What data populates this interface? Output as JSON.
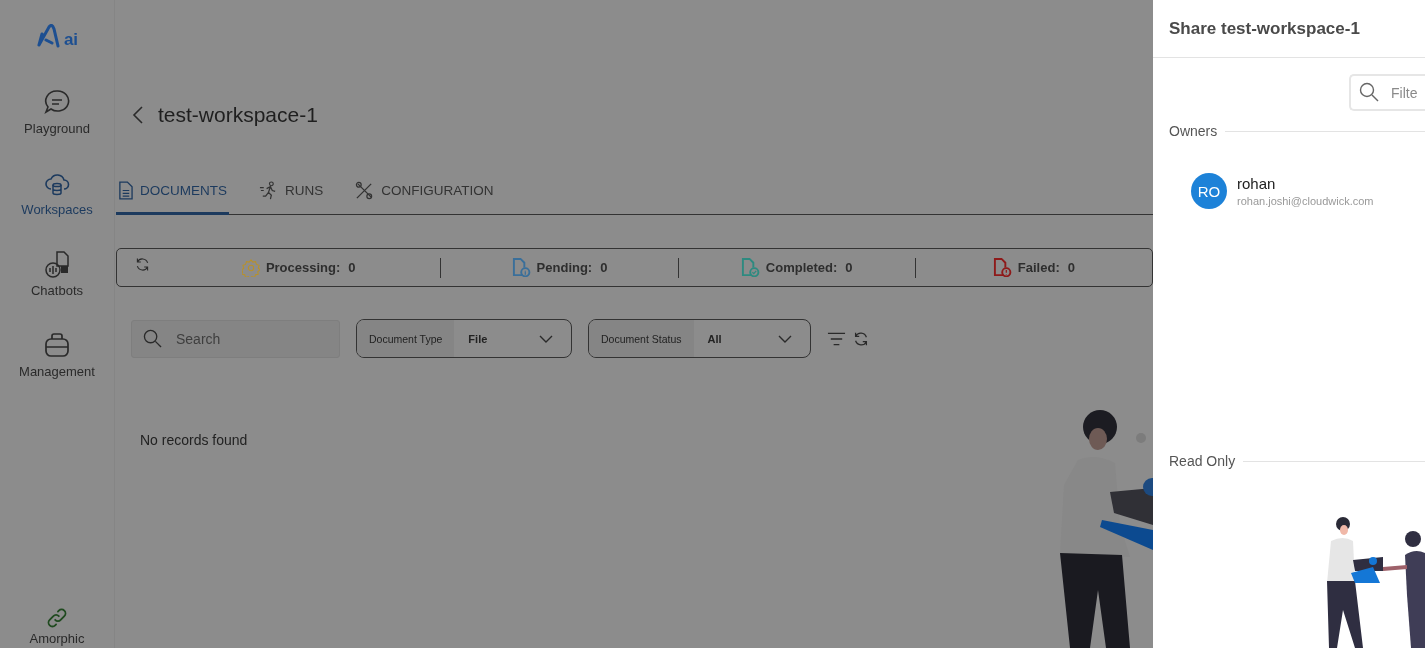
{
  "logo": {
    "text": "ai"
  },
  "sidebar": {
    "items": [
      {
        "label": "Playground",
        "kind": "chat",
        "selected": false
      },
      {
        "label": "Workspaces",
        "kind": "cloud",
        "selected": true
      },
      {
        "label": "Chatbots",
        "kind": "bot",
        "selected": false
      },
      {
        "label": "Management",
        "kind": "bag",
        "selected": false
      }
    ],
    "footer": {
      "label": "Amorphic",
      "kind": "link"
    }
  },
  "page": {
    "title": "test-workspace-1"
  },
  "tabs": [
    {
      "label": "DOCUMENTS",
      "kind": "doc",
      "selected": true
    },
    {
      "label": "RUNS",
      "kind": "run",
      "selected": false
    },
    {
      "label": "CONFIGURATION",
      "kind": "tools",
      "selected": false
    }
  ],
  "status_bar": [
    {
      "kind": "processing",
      "label": "Processing:",
      "count": "0",
      "color": "#b8912a"
    },
    {
      "kind": "pending",
      "label": "Pending:",
      "count": "0",
      "color": "#3a6f9a"
    },
    {
      "kind": "completed",
      "label": "Completed:",
      "count": "0",
      "color": "#2e8a80"
    },
    {
      "kind": "failed",
      "label": "Failed:",
      "count": "0",
      "color": "#8e1a1a"
    }
  ],
  "search": {
    "placeholder": "Search"
  },
  "filters": [
    {
      "label": "Document Type",
      "value": "File"
    },
    {
      "label": "Document Status",
      "value": "All"
    }
  ],
  "empty_message": "No records found",
  "drawer": {
    "title": "Share test-workspace-1",
    "filter": {
      "placeholder": "Filte"
    },
    "sections": [
      {
        "title": "Owners",
        "users": [
          {
            "initials": "RO",
            "name": "rohan",
            "email": "rohan.joshi@cloudwick.com"
          }
        ]
      },
      {
        "title": "Read Only"
      }
    ]
  }
}
